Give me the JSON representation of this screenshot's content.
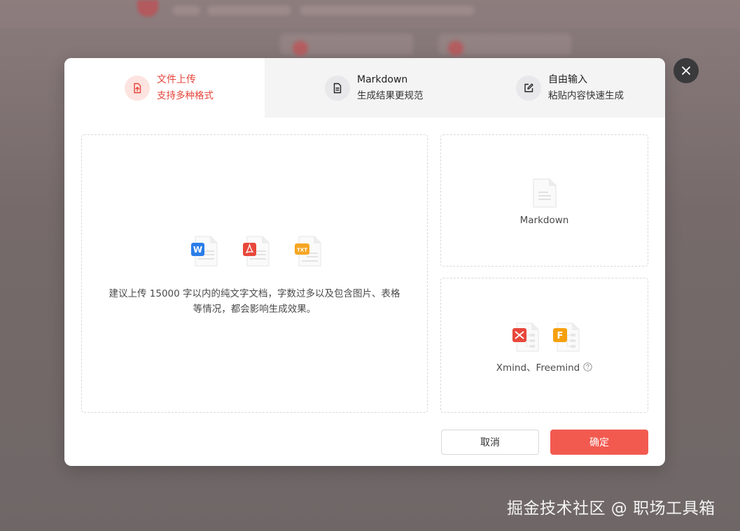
{
  "tabs": [
    {
      "title": "文件上传",
      "subtitle": "支持多种格式",
      "icon": "file-upload-icon",
      "active": true
    },
    {
      "title": "Markdown",
      "subtitle": "生成结果更规范",
      "icon": "document-icon",
      "active": false
    },
    {
      "title": "自由输入",
      "subtitle": "粘贴内容快速生成",
      "icon": "edit-icon",
      "active": false
    }
  ],
  "upload": {
    "file_types": [
      {
        "badge": "W",
        "name": "word-file-icon",
        "color": "#2b7de9"
      },
      {
        "badge": "PDF",
        "name": "pdf-file-icon",
        "color": "#e8473b"
      },
      {
        "badge": "TXT",
        "name": "txt-file-icon",
        "color": "#f5a623"
      }
    ],
    "hint_line1": "建议上传 15000 字以内的纯文字文档，字数过多以及包含图片、表格",
    "hint_line2": "等情况，都会影响生成效果。"
  },
  "side_cards": {
    "markdown_label": "Markdown",
    "mindmap_label": "Xmind、Freemind"
  },
  "buttons": {
    "cancel": "取消",
    "confirm": "确定"
  },
  "watermark": "掘金技术社区 @ 职场工具箱",
  "colors": {
    "accent": "#f25a50",
    "active_text": "#e5443a"
  }
}
